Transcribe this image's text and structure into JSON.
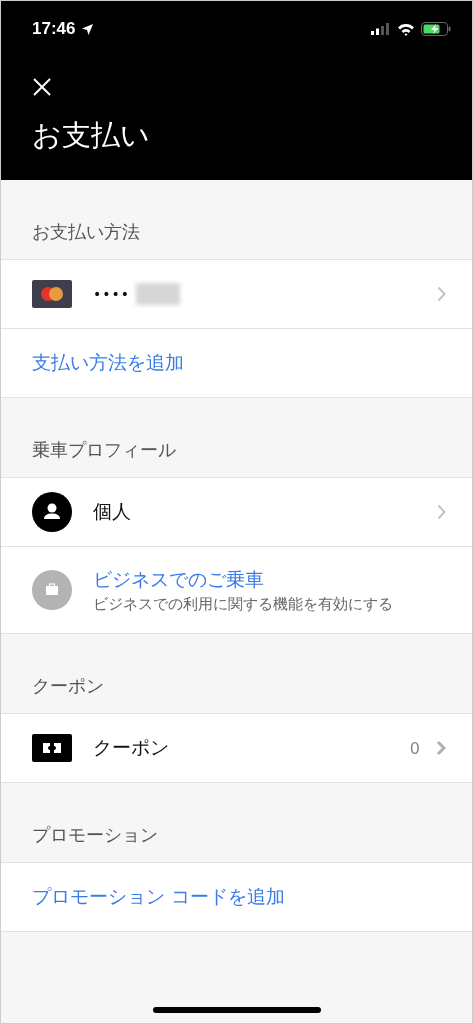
{
  "status_bar": {
    "time": "17:46"
  },
  "header": {
    "title": "お支払い"
  },
  "sections": [
    {
      "title": "お支払い方法",
      "rows": [
        {
          "kind": "card",
          "label": "••••"
        },
        {
          "kind": "link",
          "label": "支払い方法を追加"
        }
      ]
    },
    {
      "title": "乗車プロフィール",
      "rows": [
        {
          "kind": "profile",
          "label": "個人"
        },
        {
          "kind": "business",
          "label": "ビジネスでのご乗車",
          "subtitle": "ビジネスでの利用に関する機能を有効にする"
        }
      ]
    },
    {
      "title": "クーポン",
      "rows": [
        {
          "kind": "coupon",
          "label": "クーポン",
          "count": "0"
        }
      ]
    },
    {
      "title": "プロモーション",
      "rows": [
        {
          "kind": "link",
          "label": "プロモーション コードを追加"
        }
      ]
    }
  ]
}
